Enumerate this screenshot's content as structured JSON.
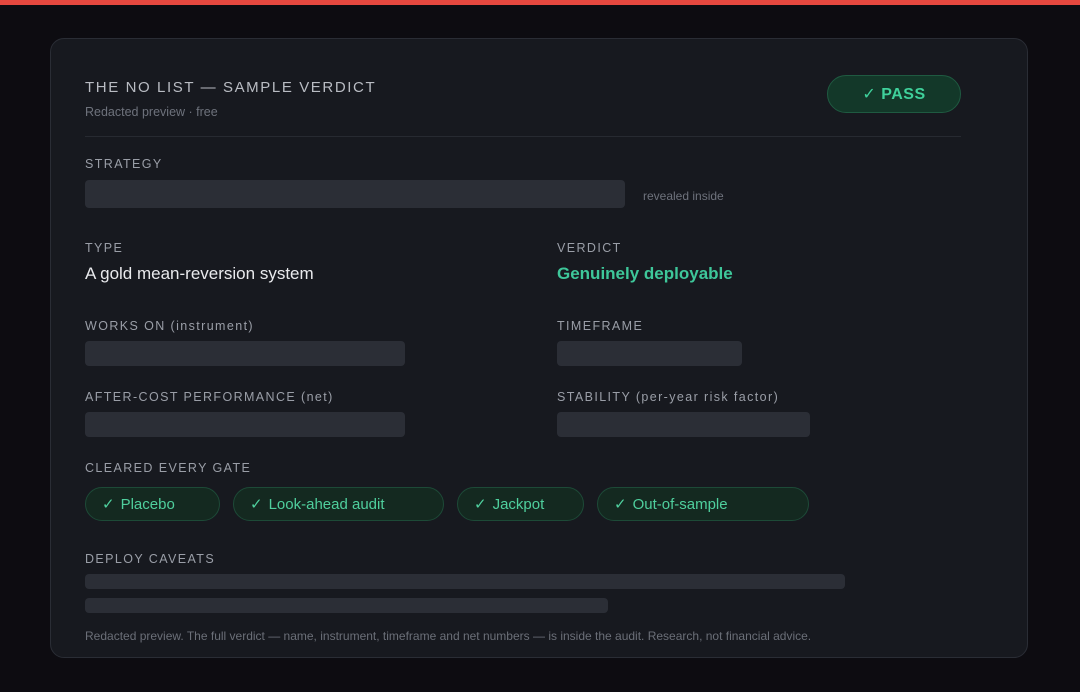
{
  "colors": {
    "top_accent": "#e5483f",
    "pass_green": "#3fd19b",
    "verdict_green": "#3ec79a",
    "gate_text": "#4fcf9d"
  },
  "card": {
    "title": "THE NO LIST — SAMPLE VERDICT",
    "subtitle": "Redacted preview · free",
    "badge": "✓ PASS"
  },
  "strategy": {
    "label": "STRATEGY",
    "note": "revealed inside"
  },
  "type": {
    "label": "TYPE",
    "value": "A gold mean-reversion system"
  },
  "verdict": {
    "label": "VERDICT",
    "value": "Genuinely deployable"
  },
  "instrument": {
    "label": "WORKS ON (instrument)"
  },
  "timeframe": {
    "label": "TIMEFRAME"
  },
  "performance": {
    "label": "AFTER-COST PERFORMANCE (net)"
  },
  "stability": {
    "label": "STABILITY (per-year risk factor)"
  },
  "gates": {
    "label": "CLEARED EVERY GATE",
    "check_icon": "check-icon",
    "items": [
      {
        "check": "✓",
        "label": "Placebo"
      },
      {
        "check": "✓",
        "label": "Look-ahead audit"
      },
      {
        "check": "✓",
        "label": "Jackpot"
      },
      {
        "check": "✓",
        "label": "Out-of-sample"
      }
    ]
  },
  "caveats": {
    "label": "DEPLOY CAVEATS"
  },
  "footnote": "Redacted preview. The full verdict — name, instrument, timeframe and net numbers — is inside the audit. Research, not financial advice."
}
